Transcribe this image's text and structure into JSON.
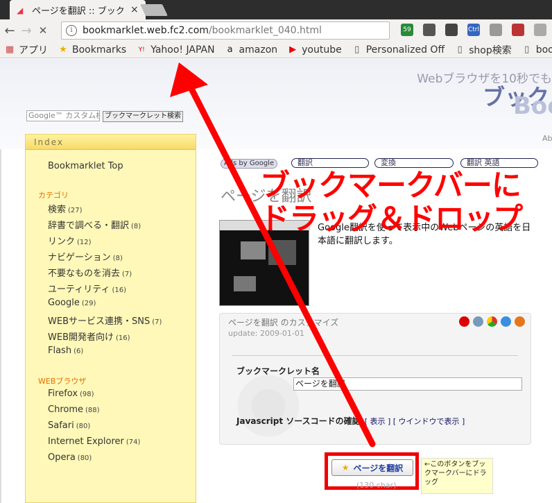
{
  "tab": {
    "title": "ページを翻訳 :: ブック",
    "close": "×"
  },
  "toolbar": {
    "back": "←",
    "forward": "→",
    "reload": "✕",
    "info": "i",
    "url_host": "bookmarklet.web.fc2.com",
    "url_path": "/bookmarklet_040.html"
  },
  "extensions": [
    {
      "icon": "green-diamond-icon",
      "badge": "59",
      "color": "#2a8a3a"
    },
    {
      "icon": "evernote-icon",
      "badge": "",
      "color": "#555"
    },
    {
      "icon": "pocket-icon",
      "badge": "",
      "color": "#444"
    },
    {
      "icon": "ctrl-icon",
      "badge": "Ctrl",
      "color": "#3566c0"
    },
    {
      "icon": "reader-icon",
      "badge": "",
      "color": "#999"
    },
    {
      "icon": "doll-icon",
      "badge": "",
      "color": "#b33"
    },
    {
      "icon": "page-icon",
      "badge": "",
      "color": "#aaa"
    },
    {
      "icon": "mail-icon",
      "badge": "",
      "color": "#aaa"
    }
  ],
  "bookmarks": [
    {
      "label": "アプリ",
      "icon": "apps-grid-icon"
    },
    {
      "label": "Bookmarks",
      "icon": "star-icon"
    },
    {
      "label": "Yahoo! JAPAN",
      "icon": "yahoo-icon"
    },
    {
      "label": "amazon",
      "icon": "amazon-icon"
    },
    {
      "label": "youtube",
      "icon": "youtube-icon"
    },
    {
      "label": "Personalized Off",
      "icon": "page-icon"
    },
    {
      "label": "shop検索",
      "icon": "page-icon"
    },
    {
      "label": "bookm",
      "icon": "page-icon"
    }
  ],
  "header": {
    "tagline": "Webブラウザを10秒でも",
    "logo_main": "ブック",
    "logo_sub": "Boo",
    "logo_small": "Ab"
  },
  "gsearch": {
    "placeholder": "Google™ カスタム検",
    "button": "ブックマークレット検索"
  },
  "sidebar": {
    "title": "Index",
    "top_link": "Bookmarklet Top",
    "cat_heading": "カテゴリ",
    "categories": [
      {
        "label": "検索",
        "count": "(27)"
      },
      {
        "label": "辞書で調べる・翻訳",
        "count": "(8)"
      },
      {
        "label": "リンク",
        "count": "(12)"
      },
      {
        "label": "ナビゲーション",
        "count": "(8)"
      },
      {
        "label": "不要なものを消去",
        "count": "(7)"
      },
      {
        "label": "ユーティリティ",
        "count": "(16)"
      },
      {
        "label": "Google",
        "count": "(29)"
      },
      {
        "label": "WEBサービス連携・SNS",
        "count": "(7)"
      },
      {
        "label": "WEB開発者向け",
        "count": "(16)"
      },
      {
        "label": "Flash",
        "count": "(6)"
      }
    ],
    "browser_heading": "WEBブラウザ",
    "browsers": [
      {
        "label": "Firefox",
        "count": "(98)"
      },
      {
        "label": "Chrome",
        "count": "(88)"
      },
      {
        "label": "Safari",
        "count": "(80)"
      },
      {
        "label": "Internet Explorer",
        "count": "(74)"
      },
      {
        "label": "Opera",
        "count": "(80)"
      }
    ]
  },
  "ads": {
    "label": "Ads by Google",
    "pills": [
      "翻訳",
      "変換",
      "翻訳 英語"
    ]
  },
  "main": {
    "title": "ページを翻訳",
    "description": "Google翻訳を使って表示中のWebページの英語を日本語に翻訳します。"
  },
  "customize": {
    "title": "ページを翻訳 のカスタマイズ",
    "update": "update: 2009-01-01",
    "name_label": "ブックマークレット名",
    "name_value": "ページを翻訳",
    "js_label": "Javascript ソースコードの確認",
    "js_links": "[ 表示 ] [ ウインドウで表示 ]"
  },
  "bookmarklet": {
    "button": "ページを翻訳",
    "char_count": "(130 char)",
    "tip": "←このボタンをブックマークバーにドラッグ"
  },
  "overlay": {
    "line1": "ブックマークバーに",
    "line2": "ドラッグ＆ドロップ"
  },
  "colors": {
    "overlay": "#ff0000",
    "sidebar": "#fff8b8",
    "link": "#2240a0"
  }
}
